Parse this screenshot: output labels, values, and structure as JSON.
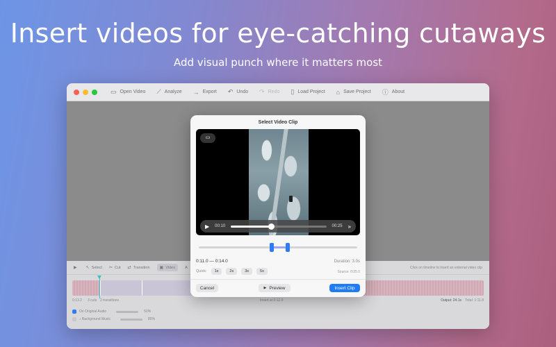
{
  "headline": "Insert videos for eye-catching cutaways",
  "subheadline": "Add visual punch where it matters most",
  "toolbar": {
    "items": [
      {
        "label": "Open Video",
        "icon": "folder-icon",
        "enabled": true
      },
      {
        "label": "Analyze",
        "icon": "wand-icon",
        "enabled": true
      },
      {
        "label": "Export",
        "icon": "arrow-right-icon",
        "enabled": true
      },
      {
        "label": "Undo",
        "icon": "undo-icon",
        "enabled": true
      },
      {
        "label": "Redo",
        "icon": "redo-icon",
        "enabled": false
      },
      {
        "label": "Load Project",
        "icon": "document-icon",
        "enabled": true
      },
      {
        "label": "Save Project",
        "icon": "save-icon",
        "enabled": true
      },
      {
        "label": "About",
        "icon": "info-icon",
        "enabled": true
      }
    ]
  },
  "timeline": {
    "tools": [
      "Select",
      "Cut",
      "Transition",
      "Video",
      "A"
    ],
    "hint": "Click on timeline to insert an external video clip",
    "stats_left_time": "0:13.2",
    "stats_left_cuts": "3 cuts",
    "stats_left_transitions": "2 transitions",
    "stats_center": "Insert at 0:12.0",
    "stats_output": "Output: 24.1s",
    "stats_total": "Total: 1:11.8",
    "audio": [
      {
        "label": "Original Audio",
        "prefix": "On",
        "value": "50%"
      },
      {
        "label": "Background Music",
        "prefix": "♪",
        "value": "80%"
      }
    ]
  },
  "dialog": {
    "title": "Select Video Clip",
    "current_time": "00:10",
    "total_time": "00:25",
    "playback_progress": 0.42,
    "range_start_frac": 0.46,
    "range_end_frac": 0.56,
    "range_label": "0:11.0 — 0:14.0",
    "duration": "Duration: 3.0s",
    "quick_label": "Quick:",
    "quick_options": [
      "1s",
      "2s",
      "3s",
      "5s"
    ],
    "source": "Source: 0:25.0",
    "cancel_label": "Cancel",
    "preview_label": "Preview",
    "insert_label": "Insert Clip"
  },
  "colors": {
    "accent": "#1f7cf5",
    "traffic_red": "#ff5f57",
    "traffic_yellow": "#febc2e",
    "traffic_green": "#28c840",
    "playhead": "#3ac0c6"
  }
}
